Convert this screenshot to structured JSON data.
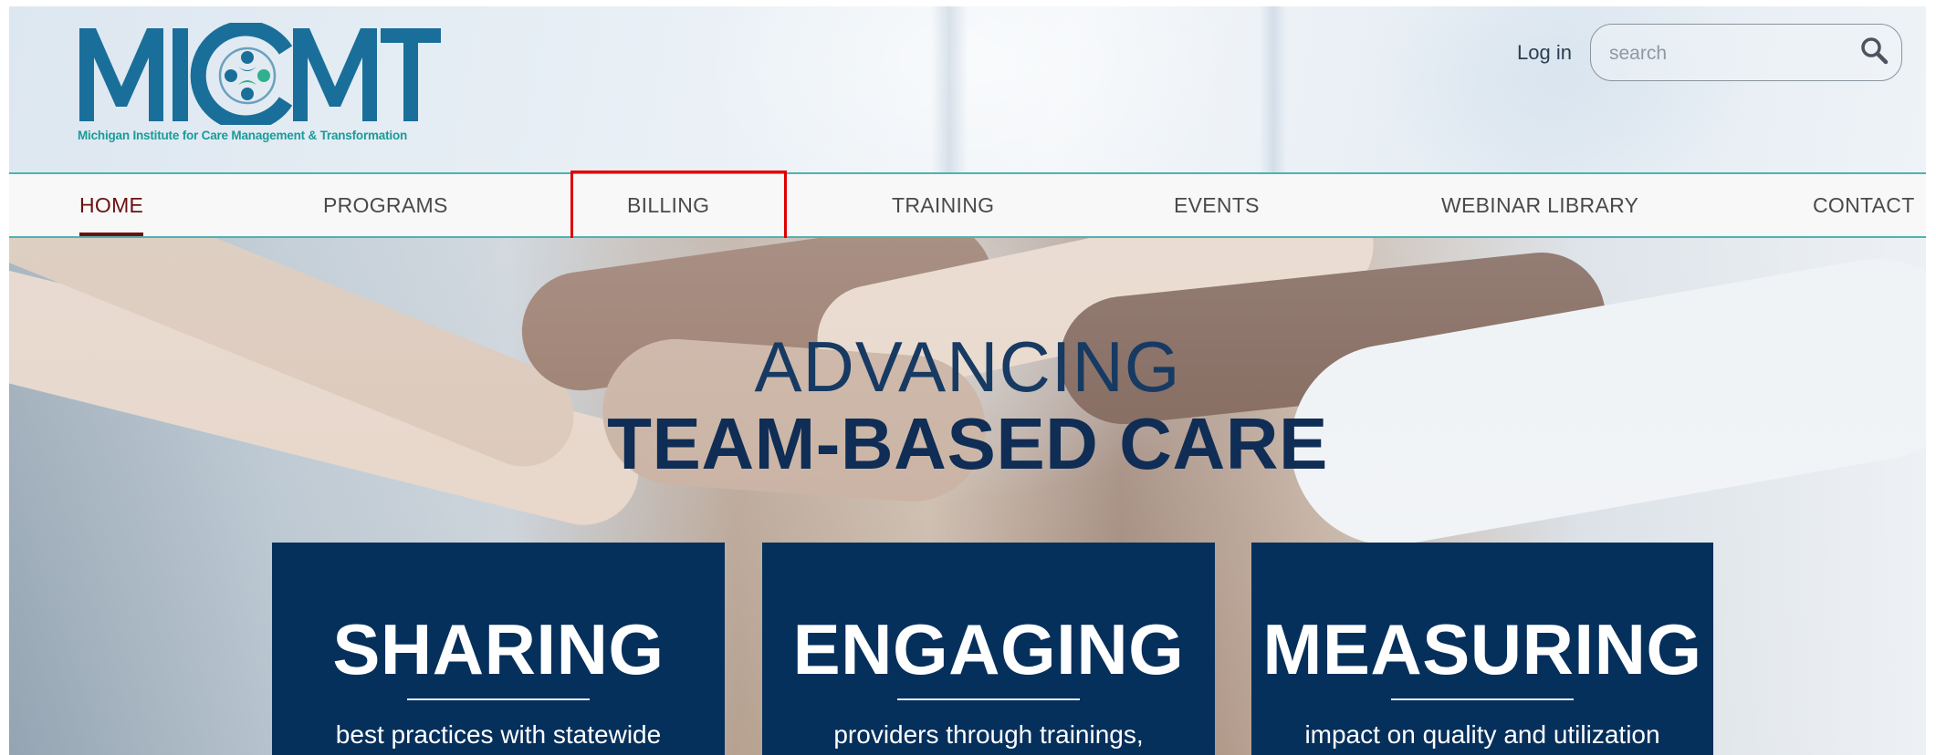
{
  "brand": {
    "logo_text": "MICMT",
    "tagline": "Michigan Institute for Care Management & Transformation"
  },
  "header": {
    "login_label": "Log in",
    "search_placeholder": "search",
    "search_value": ""
  },
  "nav": {
    "items": [
      {
        "label": "HOME",
        "active": true
      },
      {
        "label": "PROGRAMS",
        "active": false
      },
      {
        "label": "BILLING",
        "active": false
      },
      {
        "label": "TRAINING",
        "active": false
      },
      {
        "label": "EVENTS",
        "active": false
      },
      {
        "label": "WEBINAR LIBRARY",
        "active": false
      },
      {
        "label": "CONTACT",
        "active": false
      }
    ],
    "highlighted": "BILLING"
  },
  "hero": {
    "title_line1": "ADVANCING",
    "title_line2": "TEAM-BASED CARE",
    "cards": [
      {
        "title": "SHARING",
        "text": "best practices with statewide"
      },
      {
        "title": "ENGAGING",
        "text": "providers through trainings,"
      },
      {
        "title": "MEASURING",
        "text": "impact on quality and utilization"
      }
    ]
  },
  "colors": {
    "brand_blue": "#1a6f9a",
    "brand_teal": "#1a9b9a",
    "nav_border": "#4fb3b0",
    "active_nav": "#6b1111",
    "hero_title": "#0f2d55",
    "card_bg": "#06305c",
    "highlight": "#e00000"
  }
}
